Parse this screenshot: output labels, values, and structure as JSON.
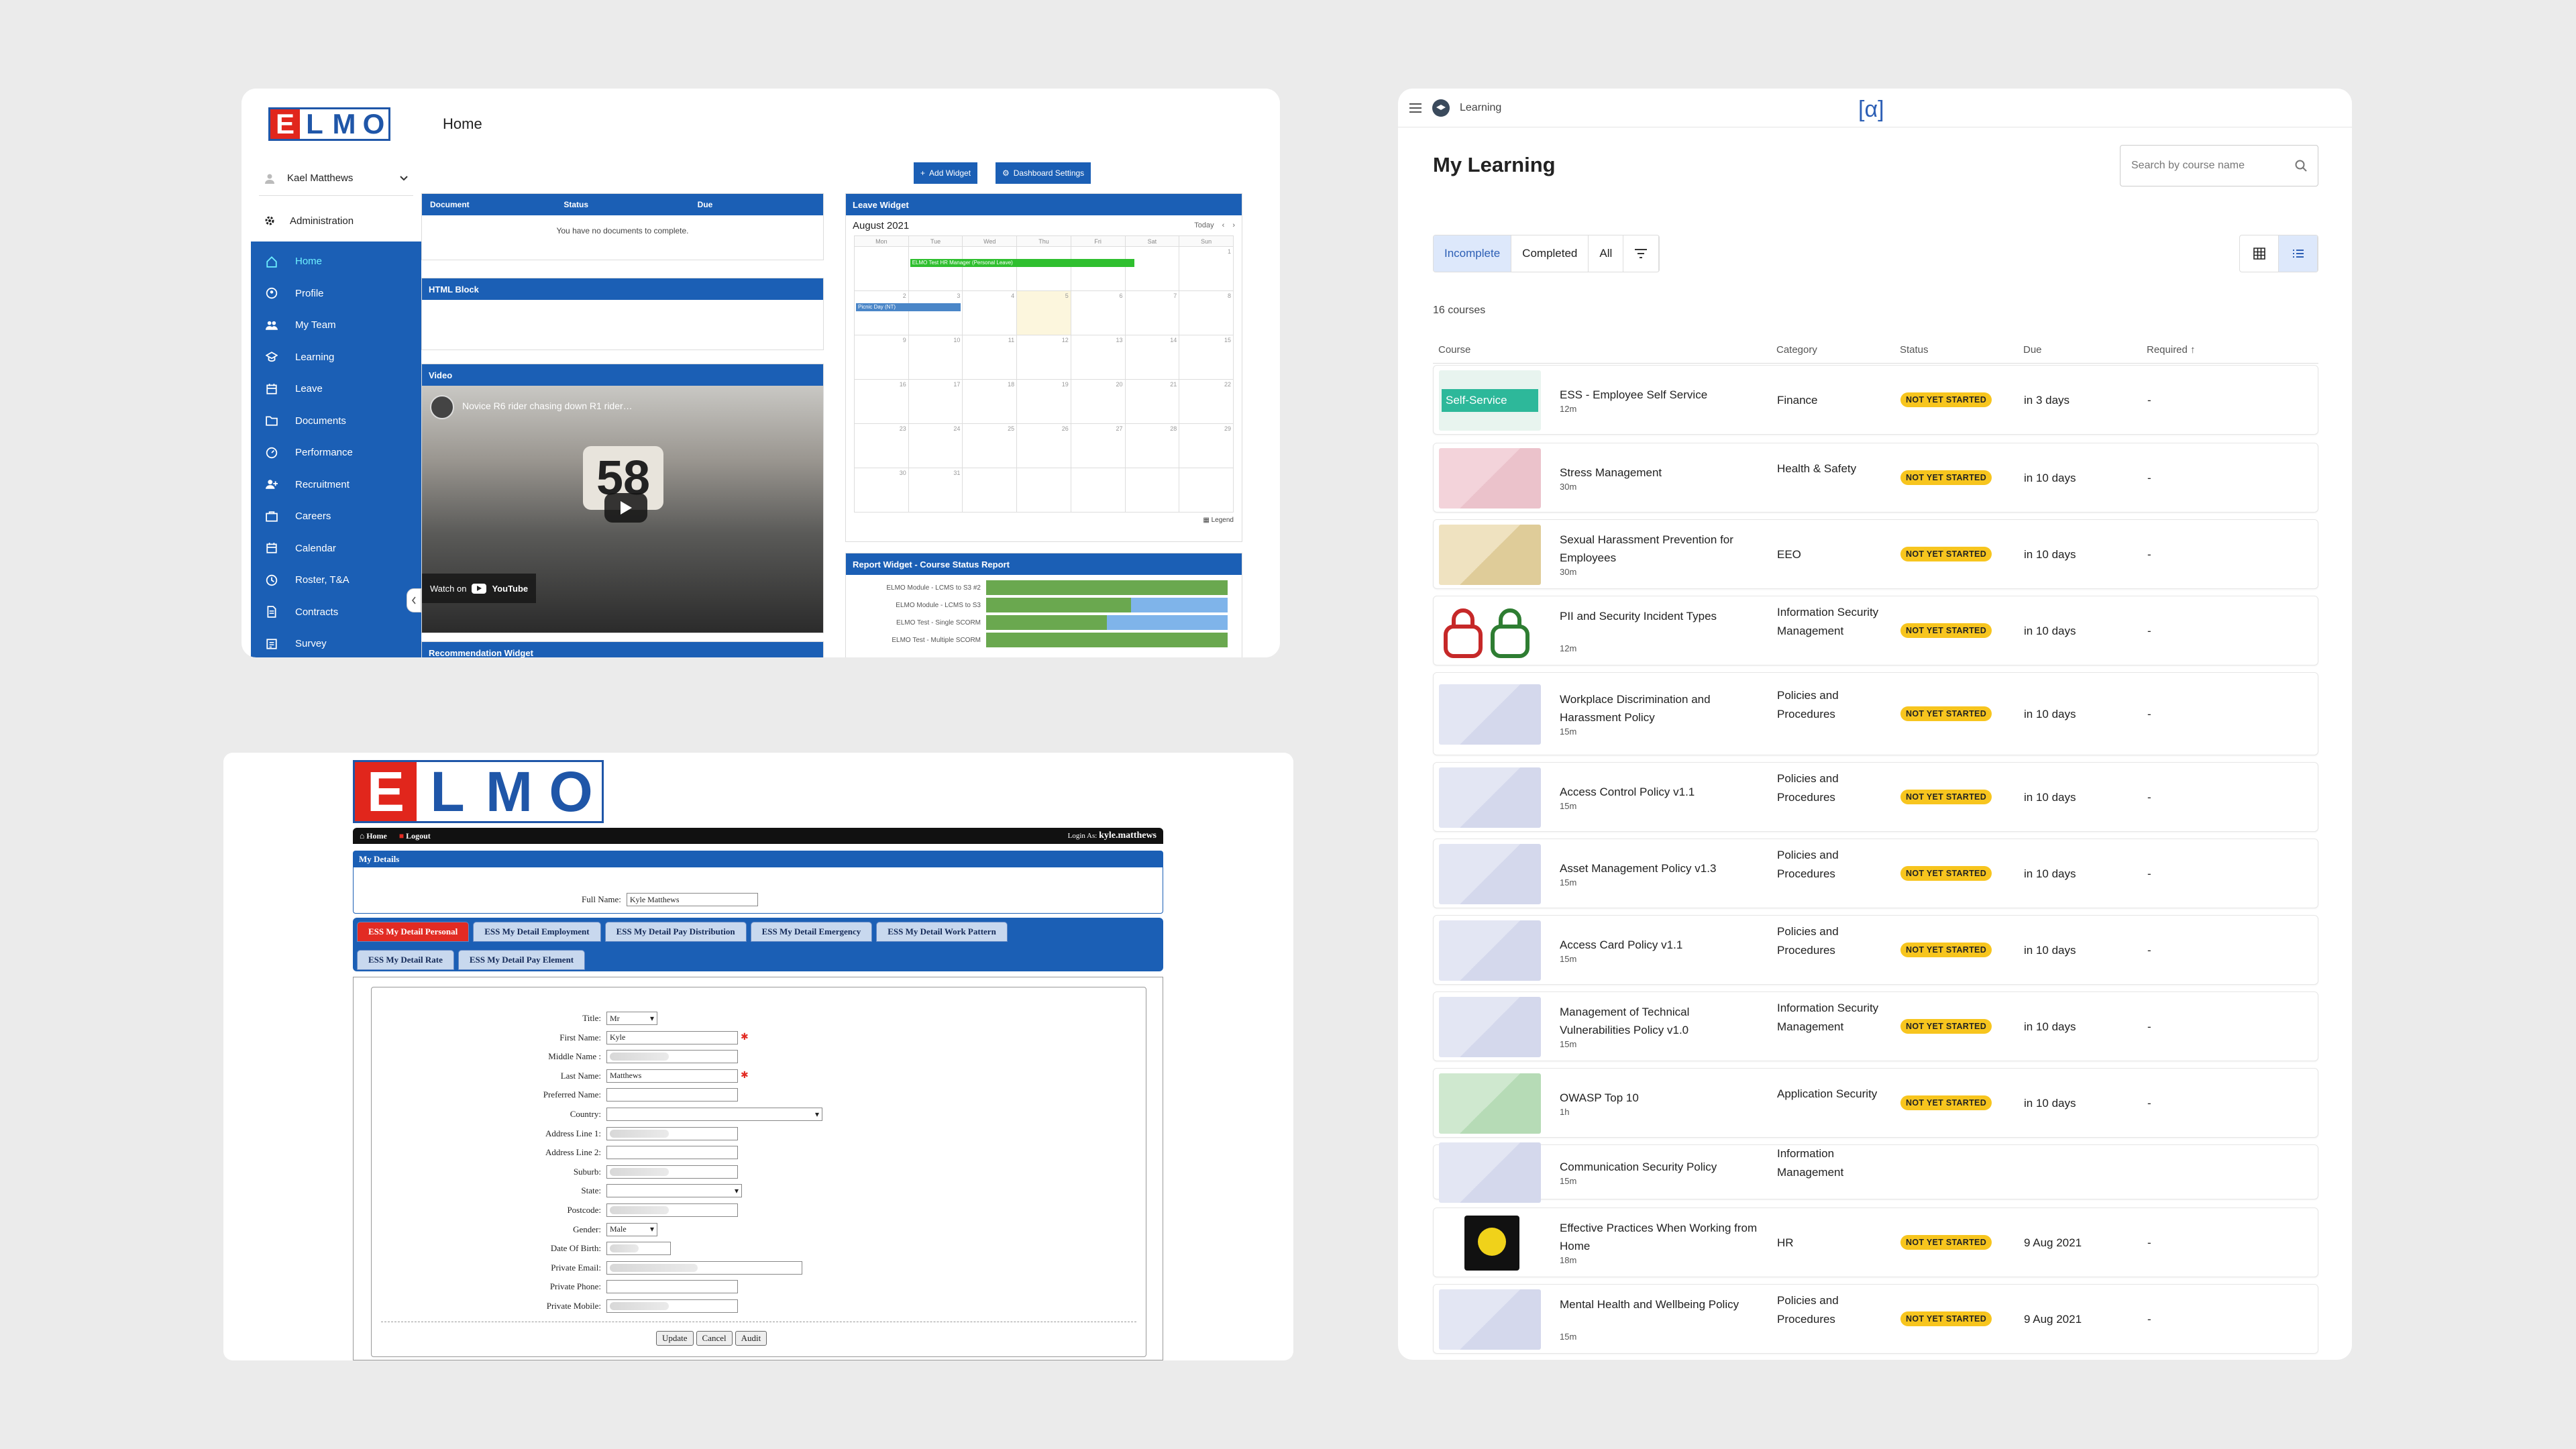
{
  "p1": {
    "user_name": "Kael Matthews",
    "admin_label": "Administration",
    "logo": [
      "E",
      "L",
      "M",
      "O"
    ],
    "nav": [
      {
        "label": "Home",
        "icon": "home-icon"
      },
      {
        "label": "Profile",
        "icon": "profile-icon"
      },
      {
        "label": "My Team",
        "icon": "team-icon"
      },
      {
        "label": "Learning",
        "icon": "learning-icon"
      },
      {
        "label": "Leave",
        "icon": "calendar-icon"
      },
      {
        "label": "Documents",
        "icon": "folder-icon"
      },
      {
        "label": "Performance",
        "icon": "gauge-icon"
      },
      {
        "label": "Recruitment",
        "icon": "recruit-icon"
      },
      {
        "label": "Careers",
        "icon": "briefcase-icon"
      },
      {
        "label": "Calendar",
        "icon": "calendar-icon"
      },
      {
        "label": "Roster, T&A",
        "icon": "clock-icon"
      },
      {
        "label": "Contracts",
        "icon": "document-icon"
      },
      {
        "label": "Survey",
        "icon": "survey-icon"
      }
    ],
    "breadcrumb": "Home",
    "add_widget": "Add Widget",
    "dashboard_settings": "Dashboard Settings",
    "doc_cols": [
      "Document",
      "Status",
      "Due"
    ],
    "doc_empty": "You have no documents to complete.",
    "html_block": "HTML Block",
    "video_title": "Video",
    "video_caption": "Novice R6 rider chasing down R1 rider…",
    "video_number": "58",
    "watch_on": "Watch on",
    "youtube": "YouTube",
    "recommendation": "Recommendation Widget",
    "leave_widget": "Leave Widget",
    "month": "August 2021",
    "today": "Today",
    "weekdays": [
      "Mon",
      "Tue",
      "Wed",
      "Thu",
      "Fri",
      "Sat",
      "Sun"
    ],
    "weeks": [
      [
        "",
        "",
        "",
        "",
        "",
        "",
        "1"
      ],
      [
        "2",
        "3",
        "4",
        "5",
        "6",
        "7",
        "8"
      ],
      [
        "9",
        "10",
        "11",
        "12",
        "13",
        "14",
        "15"
      ],
      [
        "16",
        "17",
        "18",
        "19",
        "20",
        "21",
        "22"
      ],
      [
        "23",
        "24",
        "25",
        "26",
        "27",
        "28",
        "29"
      ],
      [
        "30",
        "31",
        "",
        "",
        "",
        "",
        ""
      ]
    ],
    "event1": "ELMO Test HR Manager (Personal Leave)",
    "event2": "Picnic Day (NT)",
    "legend": "Legend",
    "report_title": "Report Widget - Course Status Report",
    "report": [
      {
        "label": "ELMO Module - LCMS to S3 #2",
        "green": 1.0,
        "blue": 0
      },
      {
        "label": "ELMO Module - LCMS to S3",
        "green": 0.6,
        "blue": 0.4
      },
      {
        "label": "ELMO Test - Single SCORM",
        "green": 0.5,
        "blue": 0.5
      },
      {
        "label": "ELMO Test - Multiple SCORM",
        "green": 1.0,
        "blue": 0
      }
    ],
    "colors": {
      "primary": "#1b5fb5",
      "green": "#6aa84f",
      "blue": "#7fb4ea",
      "event_green": "#2fbf2f",
      "event_blue": "#4a86c8"
    }
  },
  "p2": {
    "logo": [
      "E",
      "L",
      "M",
      "O"
    ],
    "home": "Home",
    "logout": "Logout",
    "login_as": "Login As:",
    "login_user": "kyle.matthews",
    "section": "My Details",
    "full_name_label": "Full Name:",
    "full_name": "Kyle Matthews",
    "tabs": [
      "ESS My Detail Personal",
      "ESS My Detail Employment",
      "ESS My Detail Pay Distribution",
      "ESS My Detail Emergency",
      "ESS My Detail Work Pattern",
      "ESS My Detail Rate",
      "ESS My Detail Pay Element"
    ],
    "fields": [
      {
        "label": "Title:",
        "value": "Mr",
        "kind": "select"
      },
      {
        "label": "First Name:",
        "value": "Kyle",
        "kind": "text",
        "required": true
      },
      {
        "label": "Middle Name :",
        "value": "",
        "kind": "blur"
      },
      {
        "label": "Last Name:",
        "value": "Matthews",
        "kind": "text",
        "required": true
      },
      {
        "label": "Preferred Name:",
        "value": "",
        "kind": "text"
      },
      {
        "label": "Country:",
        "value": "",
        "kind": "selectwide"
      },
      {
        "label": "Address Line 1:",
        "value": "",
        "kind": "blur"
      },
      {
        "label": "Address Line 2:",
        "value": "",
        "kind": "text"
      },
      {
        "label": "Suburb:",
        "value": "",
        "kind": "blur"
      },
      {
        "label": "State:",
        "value": "",
        "kind": "selectmid"
      },
      {
        "label": "Postcode:",
        "value": "",
        "kind": "blur"
      },
      {
        "label": "Gender:",
        "value": "Male",
        "kind": "select"
      },
      {
        "label": "Date Of Birth:",
        "value": "",
        "kind": "blursmall"
      },
      {
        "label": "Private Email:",
        "value": "",
        "kind": "blurwide"
      },
      {
        "label": "Private Phone:",
        "value": "",
        "kind": "text"
      },
      {
        "label": "Private Mobile:",
        "value": "",
        "kind": "blur"
      }
    ],
    "update": "Update",
    "cancel": "Cancel",
    "audit": "Audit"
  },
  "p3": {
    "app_name": "Learning",
    "alpha": "[α]",
    "title": "My Learning",
    "search_placeholder": "Search by course name",
    "filters": [
      "Incomplete",
      "Completed",
      "All"
    ],
    "count": "16 courses",
    "cols": [
      "Course",
      "Category",
      "Status",
      "Due",
      "Required"
    ],
    "courses": [
      {
        "title": "ESS - Employee Self Service",
        "dur": "12m",
        "cat": "Finance",
        "status": "NOT YET STARTED",
        "due": "in 3 days",
        "req": "-",
        "thumb": "self",
        "thumb_text": "Self-Service"
      },
      {
        "title": "Stress Management",
        "dur": "30m",
        "cat": "Health & Safety",
        "status": "NOT YET STARTED",
        "due": "in 10 days",
        "req": "-",
        "thumb": "pink"
      },
      {
        "title": "Sexual Harassment Prevention for Employees",
        "dur": "30m",
        "cat": "EEO",
        "status": "NOT YET STARTED",
        "due": "in 10 days",
        "req": "-",
        "thumb": "beige"
      },
      {
        "title": "PII and Security Incident Types",
        "dur": "12m",
        "cat": "Information Security Management",
        "status": "NOT YET STARTED",
        "due": "in 10 days",
        "req": "-",
        "thumb": "locks"
      },
      {
        "title": "Workplace Discrimination and Harassment Policy",
        "dur": "15m",
        "cat": "Policies and Procedures",
        "status": "NOT YET STARTED",
        "due": "in 10 days",
        "req": "-",
        "thumb": "lilac"
      },
      {
        "title": "Access Control Policy v1.1",
        "dur": "15m",
        "cat": "Policies and Procedures",
        "status": "NOT YET STARTED",
        "due": "in 10 days",
        "req": "-",
        "thumb": "lilac"
      },
      {
        "title": "Asset Management Policy v1.3",
        "dur": "15m",
        "cat": "Policies and Procedures",
        "status": "NOT YET STARTED",
        "due": "in 10 days",
        "req": "-",
        "thumb": "lilac"
      },
      {
        "title": "Access Card Policy v1.1",
        "dur": "15m",
        "cat": "Policies and Procedures",
        "status": "NOT YET STARTED",
        "due": "in 10 days",
        "req": "-",
        "thumb": "lilac"
      },
      {
        "title": "Management of Technical Vulnerabilities Policy v1.0",
        "dur": "15m",
        "cat": "Information Security Management",
        "status": "NOT YET STARTED",
        "due": "in 10 days",
        "req": "-",
        "thumb": "lilac"
      },
      {
        "title": "OWASP Top 10",
        "dur": "1h",
        "cat": "Application Security",
        "status": "NOT YET STARTED",
        "due": "in 10 days",
        "req": "-",
        "thumb": "green"
      },
      {
        "title": "Communication Security Policy",
        "dur": "15m",
        "cat": "Information Management",
        "status": "",
        "due": "",
        "req": "",
        "thumb": "lilac"
      },
      {
        "title": "Effective Practices When Working from Home",
        "dur": "18m",
        "cat": "HR",
        "status": "NOT YET STARTED",
        "due": "9 Aug 2021",
        "req": "-",
        "thumb": "home"
      },
      {
        "title": "Mental Health and Wellbeing Policy",
        "dur": "15m",
        "cat": "Policies and Procedures",
        "status": "NOT YET STARTED",
        "due": "9 Aug 2021",
        "req": "-",
        "thumb": "lilac"
      }
    ]
  }
}
